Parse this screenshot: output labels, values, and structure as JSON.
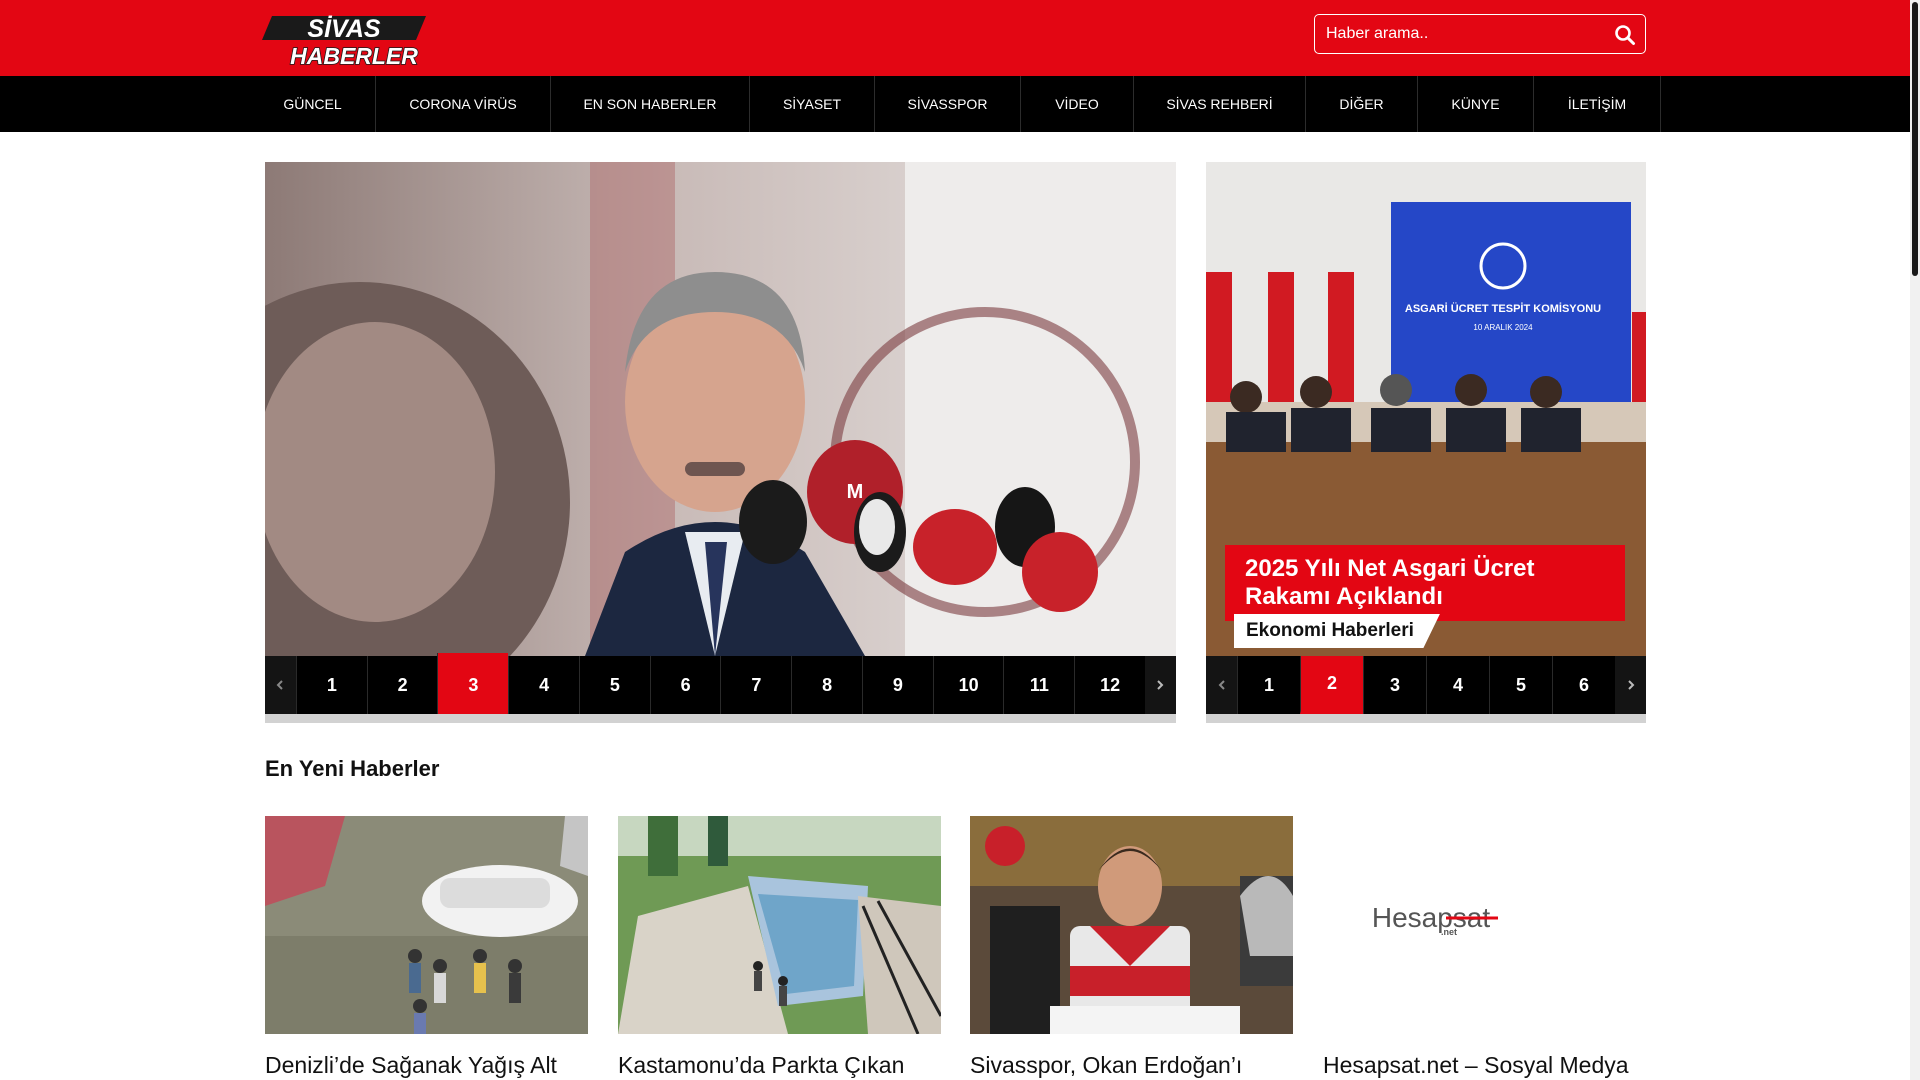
{
  "brand": {
    "logo_line1": "SİVAS",
    "logo_line2": "HABERLER",
    "accent_color": "#e30613"
  },
  "search": {
    "placeholder": "Haber arama..",
    "icon": "search-icon"
  },
  "nav": [
    {
      "label": "GÜNCEL"
    },
    {
      "label": "CORONA VİRÜS"
    },
    {
      "label": "EN SON HABERLER"
    },
    {
      "label": "SİYASET"
    },
    {
      "label": "SİVASSPOR"
    },
    {
      "label": "VİDEO"
    },
    {
      "label": "SİVAS REHBERİ"
    },
    {
      "label": "DİĞER"
    },
    {
      "label": "KÜNYE"
    },
    {
      "label": "İLETİŞİM"
    }
  ],
  "main_slider": {
    "pages": [
      "1",
      "2",
      "3",
      "4",
      "5",
      "6",
      "7",
      "8",
      "9",
      "10",
      "11",
      "12"
    ],
    "active_page": "3"
  },
  "side_slider": {
    "caption": "2025 Yılı Net Asgari Ücret Rakamı Açıklandı",
    "category": "Ekonomi Haberleri",
    "screen_title": "ASGARİ ÜCRET TESPİT KOMİSYONU",
    "screen_date": "10 ARALIK 2024",
    "pages": [
      "1",
      "2",
      "3",
      "4",
      "5",
      "6"
    ],
    "active_page": "2"
  },
  "latest": {
    "title": "En Yeni Haberler",
    "items": [
      {
        "title": "Denizli’de Sağanak Yağış Alt"
      },
      {
        "title": "Kastamonu’da Parkta Çıkan"
      },
      {
        "title": "Sivasspor, Okan Erdoğan’ı"
      },
      {
        "title": "Hesapsat.net – Sosyal Medya",
        "logo_text": "Hesapsat",
        "logo_sub": ".net"
      }
    ]
  }
}
